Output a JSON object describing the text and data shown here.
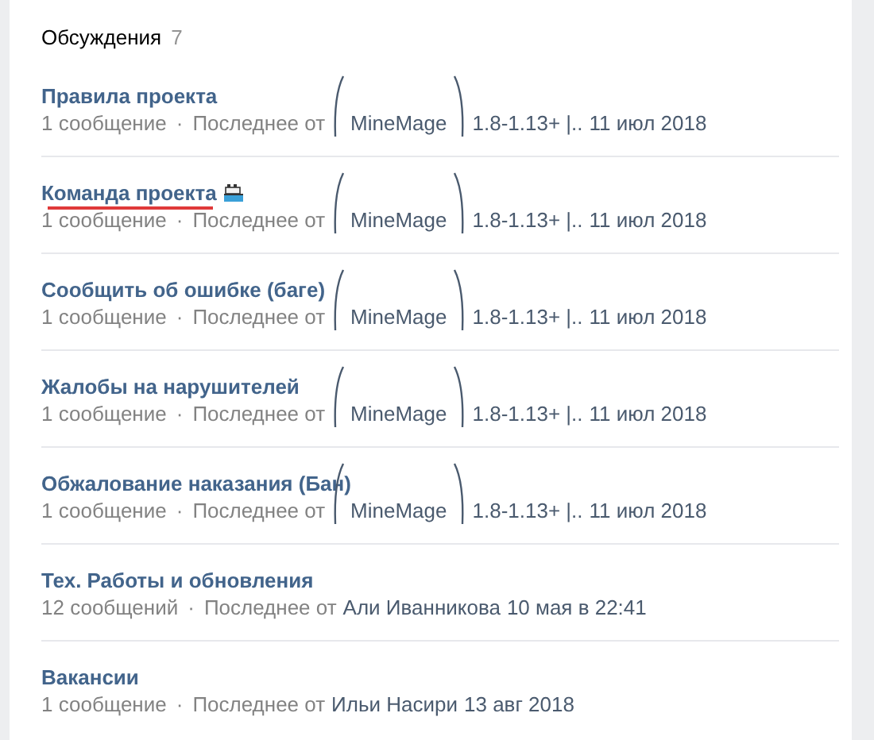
{
  "header": {
    "title": "Обсуждения",
    "count": "7"
  },
  "topics": [
    {
      "title": "Правила проекта",
      "has_icon": false,
      "underlined": false,
      "messages": "1 сообщение",
      "separator": "·",
      "last_from": "Последнее от",
      "author": "MineMage",
      "author_suffix": "1.8-1.13+ |..",
      "date": "11 июл 2018",
      "bracketed": true
    },
    {
      "title": "Команда проекта",
      "has_icon": true,
      "underlined": true,
      "messages": "1 сообщение",
      "separator": "·",
      "last_from": "Последнее от",
      "author": "MineMage",
      "author_suffix": "1.8-1.13+ |..",
      "date": "11 июл 2018",
      "bracketed": true
    },
    {
      "title": "Сообщить об ошибке (баге)",
      "has_icon": false,
      "underlined": false,
      "messages": "1 сообщение",
      "separator": "·",
      "last_from": "Последнее от",
      "author": "MineMage",
      "author_suffix": "1.8-1.13+ |..",
      "date": "11 июл 2018",
      "bracketed": true
    },
    {
      "title": "Жалобы на нарушителей",
      "has_icon": false,
      "underlined": false,
      "messages": "1 сообщение",
      "separator": "·",
      "last_from": "Последнее от",
      "author": "MineMage",
      "author_suffix": "1.8-1.13+ |..",
      "date": "11 июл 2018",
      "bracketed": true
    },
    {
      "title": "Обжалование наказания (Бан)",
      "has_icon": false,
      "underlined": false,
      "messages": "1 сообщение",
      "separator": "·",
      "last_from": "Последнее от",
      "author": "MineMage",
      "author_suffix": "1.8-1.13+ |..",
      "date": "11 июл 2018",
      "bracketed": true
    },
    {
      "title": "Тех. Работы и обновления",
      "has_icon": false,
      "underlined": false,
      "messages": "12 сообщений",
      "separator": "·",
      "last_from": "Последнее от",
      "author": "Али Иванникова",
      "date": "10 мая в 22:41",
      "bracketed": false
    },
    {
      "title": "Вакансии",
      "has_icon": false,
      "underlined": false,
      "messages": "1 сообщение",
      "separator": "·",
      "last_from": "Последнее от",
      "author": "Ильи Насири",
      "date": "13 авг 2018",
      "bracketed": false
    }
  ]
}
